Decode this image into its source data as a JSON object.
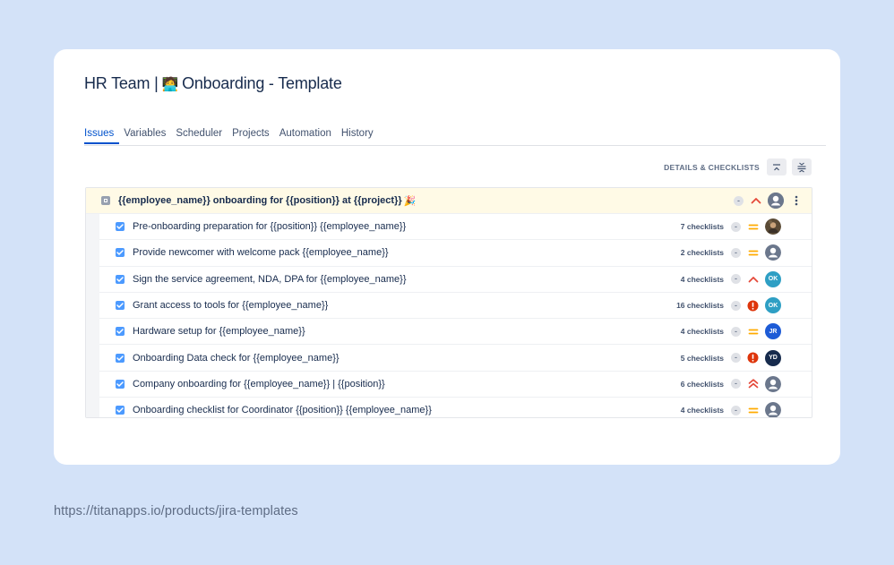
{
  "page": {
    "title": "HR Team | 🧑‍💻 Onboarding - Template",
    "title_prefix": "HR Team |",
    "title_suffix": "Onboarding - Template",
    "url": "https://titanapps.io/products/jira-templates"
  },
  "tabs": [
    {
      "label": "Issues",
      "active": true
    },
    {
      "label": "Variables",
      "active": false
    },
    {
      "label": "Scheduler",
      "active": false
    },
    {
      "label": "Projects",
      "active": false
    },
    {
      "label": "Automation",
      "active": false
    },
    {
      "label": "History",
      "active": false
    }
  ],
  "toolbar": {
    "details_label": "DETAILS & CHECKLISTS"
  },
  "parent_issue": {
    "summary": "{{employee_name}} onboarding for {{position}} at {{project}}",
    "status": "-",
    "priority": "high",
    "assignee": "unassigned"
  },
  "child_issues": [
    {
      "summary": "Pre-onboarding preparation for {{position}} {{employee_name}}",
      "checklists": "7 checklists",
      "status": "-",
      "priority": "medium",
      "avatar": {
        "type": "photo",
        "initials": "",
        "color": "#5a4a35"
      }
    },
    {
      "summary": "Provide newcomer with welcome pack {{employee_name}}",
      "checklists": "2 checklists",
      "status": "-",
      "priority": "medium",
      "avatar": {
        "type": "default",
        "initials": "",
        "color": "#6b778c"
      }
    },
    {
      "summary": "Sign the service agreement, NDA, DPA for {{employee_name}}",
      "checklists": "4 checklists",
      "status": "-",
      "priority": "high",
      "avatar": {
        "type": "initials",
        "initials": "OK",
        "color": "#2e9fc4"
      }
    },
    {
      "summary": "Grant access to tools for {{employee_name}}",
      "checklists": "16 checklists",
      "status": "-",
      "priority": "blocker",
      "avatar": {
        "type": "initials",
        "initials": "OK",
        "color": "#2e9fc4"
      }
    },
    {
      "summary": "Hardware setup for {{employee_name}}",
      "checklists": "4 checklists",
      "status": "-",
      "priority": "medium",
      "avatar": {
        "type": "initials",
        "initials": "JR",
        "color": "#1d5bd6"
      }
    },
    {
      "summary": "Onboarding Data check for {{employee_name}}",
      "checklists": "5 checklists",
      "status": "-",
      "priority": "blocker",
      "avatar": {
        "type": "initials",
        "initials": "YD",
        "color": "#172b4d"
      }
    },
    {
      "summary": "Company onboarding for {{employee_name}} | {{position}}",
      "checklists": "6 checklists",
      "status": "-",
      "priority": "highest",
      "avatar": {
        "type": "default",
        "initials": "",
        "color": "#6b778c"
      }
    },
    {
      "summary": "Onboarding checklist for Coordinator {{position}} {{employee_name}}",
      "checklists": "4 checklists",
      "status": "-",
      "priority": "medium",
      "avatar": {
        "type": "default",
        "initials": "",
        "color": "#6b778c"
      }
    }
  ],
  "colors": {
    "background": "#d3e2f8",
    "accent": "#0052cc",
    "parent_row": "#fffae6",
    "priority_high": "#e5493a",
    "priority_medium": "#ffab00",
    "priority_blocker": "#de350b"
  }
}
